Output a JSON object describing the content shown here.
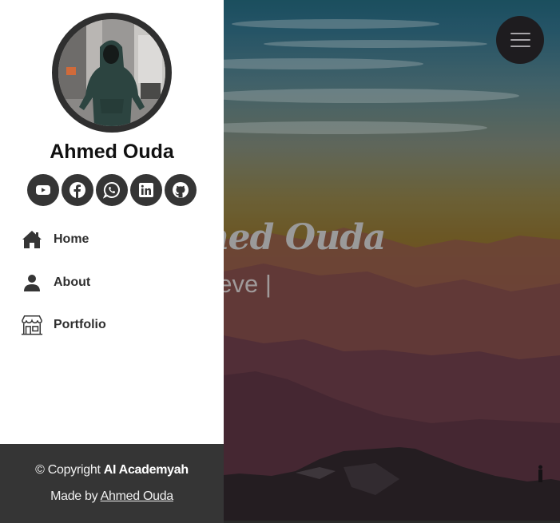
{
  "hero": {
    "title": "Ahmed Ouda",
    "typed_text": "I'm a Deve",
    "cursor": "|",
    "menu_icon": "hamburger-icon"
  },
  "sidebar": {
    "profile_name": "Ahmed Ouda",
    "avatar_alt": "Profile photo of a person in a hooded sweatshirt on a city street",
    "social_links": [
      {
        "name": "YouTube",
        "icon": "youtube-icon"
      },
      {
        "name": "Facebook",
        "icon": "facebook-icon"
      },
      {
        "name": "WhatsApp",
        "icon": "whatsapp-icon"
      },
      {
        "name": "LinkedIn",
        "icon": "linkedin-icon"
      },
      {
        "name": "GitHub",
        "icon": "github-icon"
      }
    ],
    "nav": [
      {
        "label": "Home",
        "icon": "home-icon"
      },
      {
        "label": "About",
        "icon": "user-icon"
      },
      {
        "label": "Portfolio",
        "icon": "shop-icon"
      }
    ]
  },
  "footer": {
    "copyright_prefix": "© Copyright ",
    "copyright_brand": "AI Academyah",
    "made_by_prefix": "Made by ",
    "made_by_link": "Ahmed Ouda"
  },
  "colors": {
    "sidebar_bg": "#ffffff",
    "icon_dark": "#353535",
    "footer_bg": "#353535",
    "menu_button": "#1e1c1f"
  }
}
